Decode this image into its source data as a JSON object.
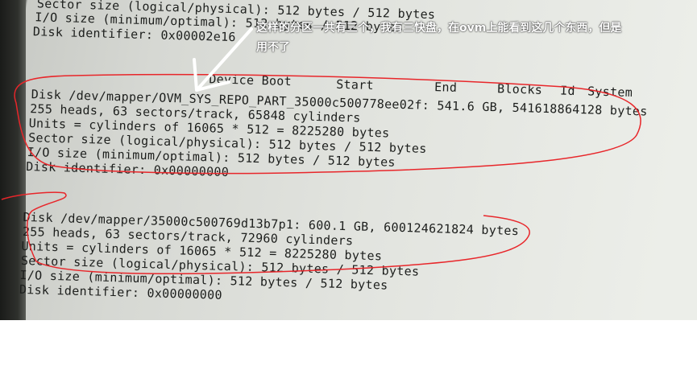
{
  "terminal": {
    "top_block": [
      "Sector size (logical/physical): 512 bytes / 512 bytes",
      "I/O size (minimum/optimal): 512 bytes / 512 bytes",
      "Disk identifier: 0x00002e16"
    ],
    "header": [
      "Device Boot",
      "Start",
      "End",
      "Blocks",
      "Id",
      "System"
    ],
    "disk1": [
      "Disk /dev/mapper/OVM_SYS_REPO_PART_35000c500778ee02f: 541.6 GB, 541618864128 bytes",
      "255 heads, 63 sectors/track, 65848 cylinders",
      "Units = cylinders of 16065 * 512 = 8225280 bytes",
      "Sector size (logical/physical): 512 bytes / 512 bytes",
      "I/O size (minimum/optimal): 512 bytes / 512 bytes",
      "Disk identifier: 0x00000000"
    ],
    "disk2": [
      "Disk /dev/mapper/35000c500769d13b7p1: 600.1 GB, 600124621824 bytes",
      "255 heads, 63 sectors/track, 72960 cylinders",
      "Units = cylinders of 16065 * 512 = 8225280 bytes",
      "Sector size (logical/physical): 512 bytes / 512 bytes",
      "I/O size (minimum/optimal): 512 bytes / 512 bytes",
      "Disk identifier: 0x00000000"
    ]
  },
  "annotation": {
    "line1": "这样的分区一共有三个，我有三快盘，在ovm上能看到这几个东西，但是",
    "line2": "用不了"
  },
  "colors": {
    "ink": "#1c1e1c",
    "circle": "#e8262a",
    "arrow": "#ffffff"
  },
  "icons": {
    "arrow": "white-arrow-icon"
  }
}
